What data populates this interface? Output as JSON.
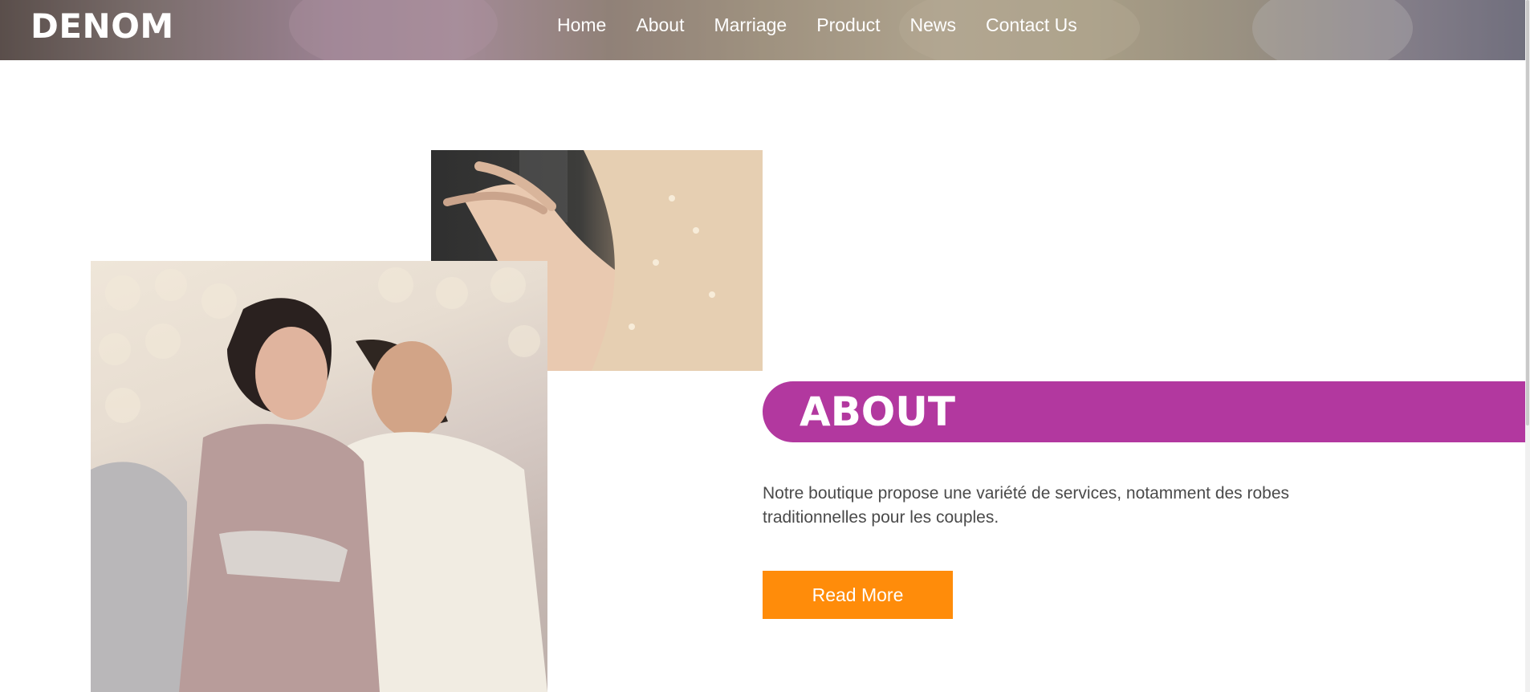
{
  "brand": {
    "logo": "DENOM"
  },
  "nav": {
    "items": [
      {
        "label": "Home"
      },
      {
        "label": "About"
      },
      {
        "label": "Marriage"
      },
      {
        "label": "Product"
      },
      {
        "label": "News"
      },
      {
        "label": "Contact Us"
      }
    ]
  },
  "about": {
    "title": "ABOUT",
    "description": "Notre boutique propose une variété de services, notamment des robes traditionnelles pour les couples.",
    "button_label": "Read More"
  },
  "colors": {
    "accent_band": "#b2389f",
    "button": "#ff8c0a",
    "text": "#4a4a4a"
  }
}
